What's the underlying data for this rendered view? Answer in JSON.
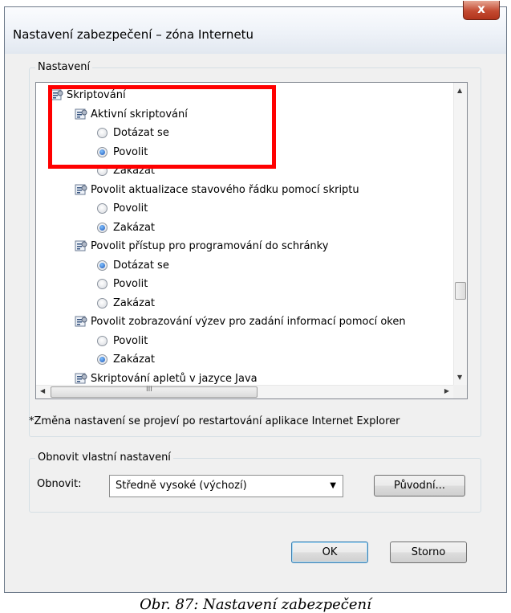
{
  "window": {
    "title": "Nastavení zabezpečení – zóna Internetu",
    "close_label": "x"
  },
  "settings_group": {
    "legend": "Nastavení"
  },
  "tree_items": [
    {
      "type": "category",
      "label": "Skriptování"
    },
    {
      "type": "setting",
      "label": "Aktivní skriptování"
    },
    {
      "type": "option",
      "label": "Dotázat se",
      "selected": false
    },
    {
      "type": "option",
      "label": "Povolit",
      "selected": true
    },
    {
      "type": "option",
      "label": "Zakázat",
      "selected": false
    },
    {
      "type": "setting",
      "label": "Povolit aktualizace stavového řádku pomocí skriptu"
    },
    {
      "type": "option",
      "label": "Povolit",
      "selected": false
    },
    {
      "type": "option",
      "label": "Zakázat",
      "selected": true
    },
    {
      "type": "setting",
      "label": "Povolit přístup pro programování do schránky"
    },
    {
      "type": "option",
      "label": "Dotázat se",
      "selected": true
    },
    {
      "type": "option",
      "label": "Povolit",
      "selected": false
    },
    {
      "type": "option",
      "label": "Zakázat",
      "selected": false
    },
    {
      "type": "setting",
      "label": "Povolit zobrazování výzev pro zadání informací pomocí oken"
    },
    {
      "type": "option",
      "label": "Povolit",
      "selected": false
    },
    {
      "type": "option",
      "label": "Zakázat",
      "selected": true
    },
    {
      "type": "setting",
      "label": "Skriptování apletů v jazyce Java"
    }
  ],
  "scrollbar": {
    "vertical_position": 0.72,
    "hscroll_grip": "III"
  },
  "restart_note": "*Změna nastavení se projeví po restartování aplikace Internet Explorer",
  "reset_group": {
    "legend": "Obnovit vlastní nastavení",
    "label": "Obnovit:",
    "selected_level": "Středně vysoké (výchozí)",
    "reset_button": "Původní..."
  },
  "buttons": {
    "ok": "OK",
    "cancel": "Storno"
  },
  "caption": "Obr. 87: Nastavení zabezpečení",
  "colors": {
    "highlight": "#ff0000",
    "dialog_bg": "#f0f0f0",
    "close_button": "#c44a31"
  },
  "icons": {
    "category": "script-settings-icon",
    "setting": "script-settings-icon",
    "option": "radio-button"
  }
}
